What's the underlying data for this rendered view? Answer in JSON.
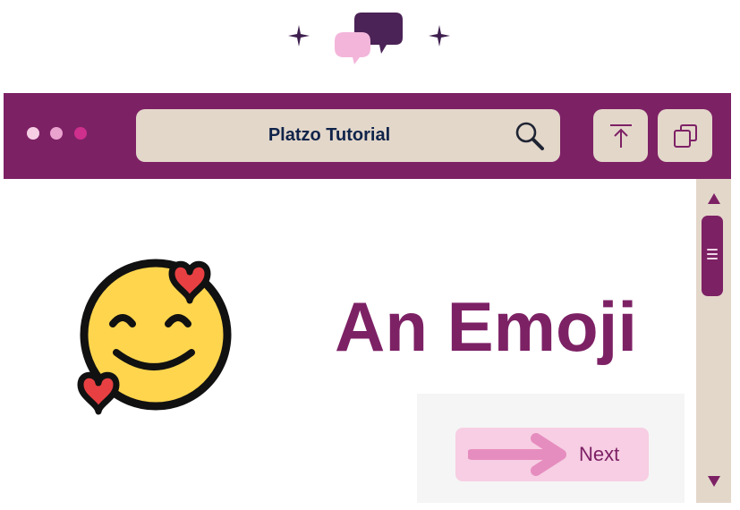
{
  "window": {
    "address_text": "Platzo Tutorial",
    "buttons": [
      "share-icon",
      "copy-icon"
    ]
  },
  "main": {
    "heading": "An Emoji",
    "emoji_icon": "smiling-face-with-hearts",
    "next_button_label": "Next"
  },
  "colors": {
    "brand": "#7d2165",
    "address_bar": "#e3d7ca",
    "text_dark": "#10244a",
    "button_pink": "#f7cee3",
    "arrow_pink": "#e68dbf"
  }
}
